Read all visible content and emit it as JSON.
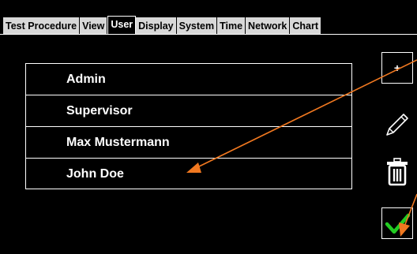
{
  "tabs": [
    {
      "label": "Test Procedure",
      "active": false
    },
    {
      "label": "View",
      "active": false
    },
    {
      "label": "User",
      "active": true
    },
    {
      "label": "Display",
      "active": false
    },
    {
      "label": "System",
      "active": false
    },
    {
      "label": "Time",
      "active": false
    },
    {
      "label": "Network",
      "active": false
    },
    {
      "label": "Chart",
      "active": false
    }
  ],
  "users": [
    "Admin",
    "Supervisor",
    "Max Mustermann",
    "John Doe"
  ],
  "actions": {
    "add_label": "+",
    "edit_icon": "pencil-icon",
    "delete_icon": "trash-icon",
    "confirm_icon": "checkmark-icon"
  },
  "colors": {
    "background": "#000000",
    "tab_inactive": "#d8d8d8",
    "annotation_arrow": "#f07820",
    "confirm_check": "#22cc22"
  }
}
